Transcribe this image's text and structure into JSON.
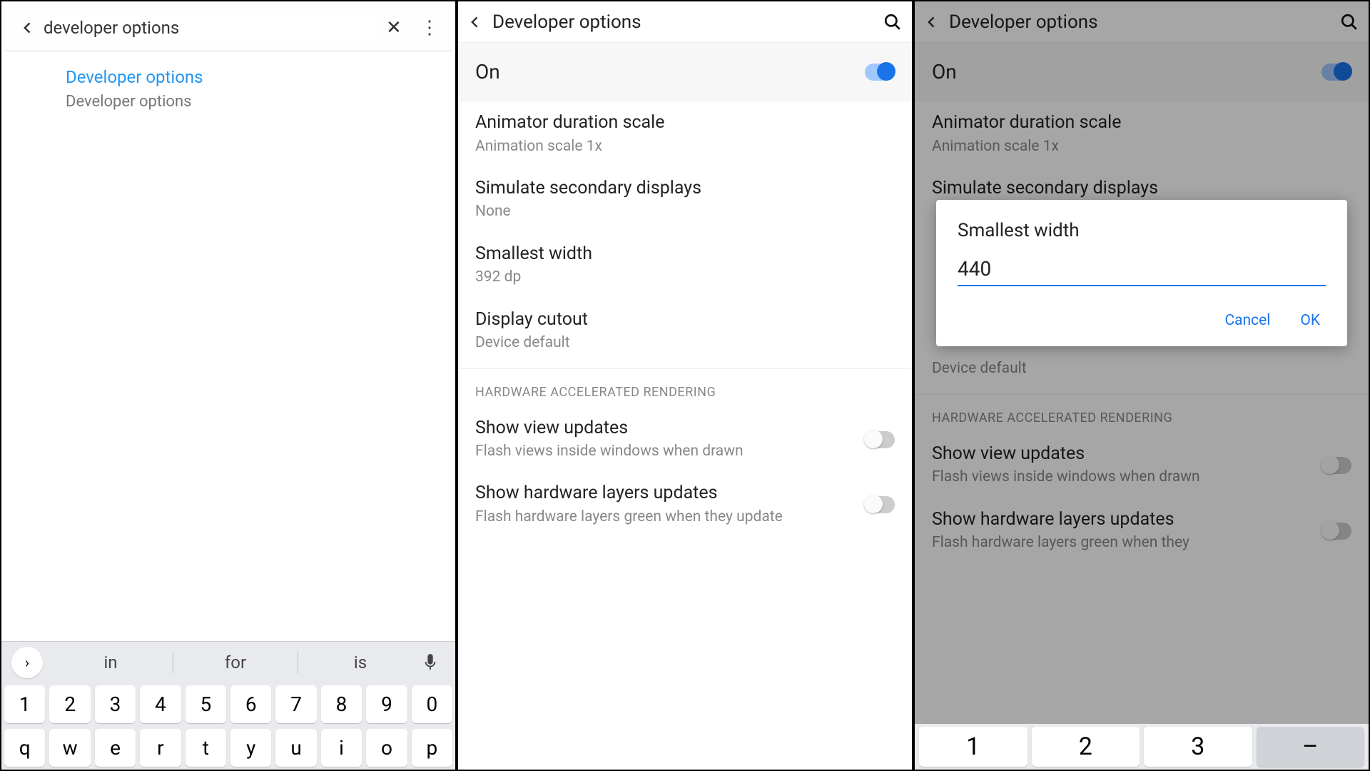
{
  "panel1": {
    "search_value": "developer options",
    "result_title": "Developer options",
    "result_sub": "Developer options",
    "suggestions": [
      "in",
      "for",
      "is"
    ],
    "key_row1": [
      "1",
      "2",
      "3",
      "4",
      "5",
      "6",
      "7",
      "8",
      "9",
      "0"
    ],
    "key_row2": [
      "q",
      "w",
      "e",
      "r",
      "t",
      "y",
      "u",
      "i",
      "o",
      "p"
    ]
  },
  "panel2": {
    "title": "Developer options",
    "on_label": "On",
    "settings": [
      {
        "title": "Animator duration scale",
        "sub": "Animation scale 1x"
      },
      {
        "title": "Simulate secondary displays",
        "sub": "None"
      },
      {
        "title": "Smallest width",
        "sub": "392 dp"
      },
      {
        "title": "Display cutout",
        "sub": "Device default"
      }
    ],
    "section_header": "HARDWARE ACCELERATED RENDERING",
    "hw_settings": [
      {
        "title": "Show view updates",
        "sub": "Flash views inside windows when drawn"
      },
      {
        "title": "Show hardware layers updates",
        "sub": "Flash hardware layers green when they update"
      }
    ]
  },
  "panel3": {
    "title": "Developer options",
    "on_label": "On",
    "settings": [
      {
        "title": "Animator duration scale",
        "sub": "Animation scale 1x"
      },
      {
        "title": "Simulate secondary displays",
        "sub": ""
      }
    ],
    "cutout_sub": "Device default",
    "section_header": "HARDWARE ACCELERATED RENDERING",
    "hw_settings": [
      {
        "title": "Show view updates",
        "sub": "Flash views inside windows when drawn"
      },
      {
        "title": "Show hardware layers updates",
        "sub": "Flash hardware layers green when they"
      }
    ],
    "dialog": {
      "title": "Smallest width",
      "value": "440",
      "cancel": "Cancel",
      "ok": "OK"
    },
    "numpad": [
      "1",
      "2",
      "3",
      "–"
    ]
  }
}
